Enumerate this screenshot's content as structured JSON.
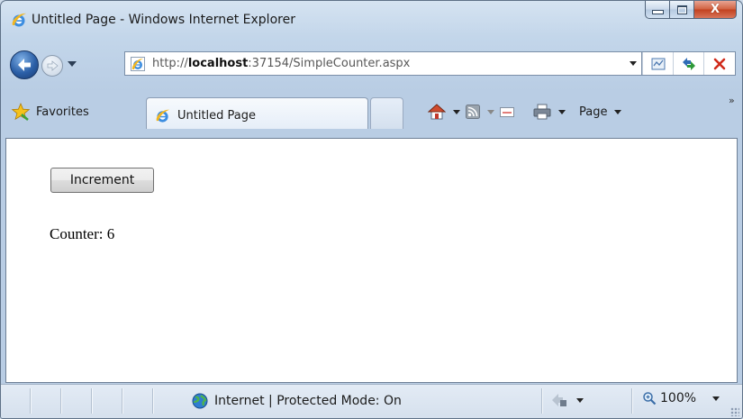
{
  "window": {
    "title": "Untitled Page - Windows Internet Explorer",
    "controls": {
      "minimize": "minimize",
      "maximize": "maximize",
      "close": "X"
    }
  },
  "nav": {
    "address_prefix": "http://",
    "address_host": "localhost",
    "address_rest": ":37154/SimpleCounter.aspx",
    "icons": [
      "back-icon",
      "forward-icon",
      "compatibility-view-icon",
      "refresh-icon",
      "stop-icon"
    ]
  },
  "toolbar": {
    "favorites_label": "Favorites",
    "tab_title": "Untitled Page",
    "page_menu_label": "Page",
    "chevron": "»",
    "icons": [
      "home-icon",
      "feeds-icon",
      "mail-icon",
      "print-icon"
    ]
  },
  "content": {
    "button_label": "Increment",
    "counter_text": "Counter: 6"
  },
  "status": {
    "zone_text": "Internet | Protected Mode: On",
    "zoom_text": "100%"
  },
  "colors": {
    "frame": "#b9cde4",
    "close_button": "#c2401e",
    "ie_blue": "#1e73c8",
    "ie_ring": "#f2b61f"
  }
}
